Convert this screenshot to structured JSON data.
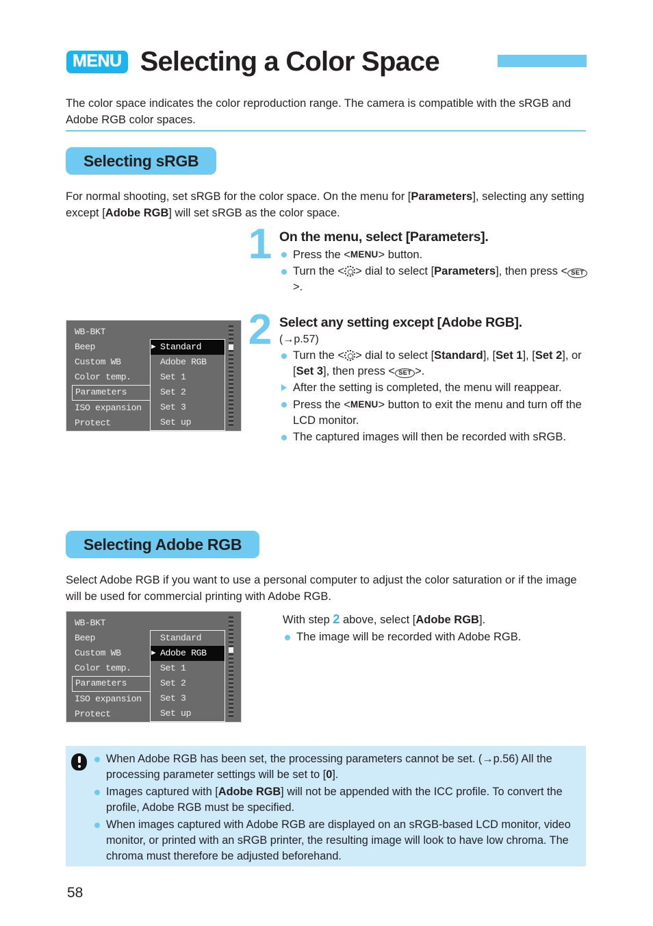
{
  "header": {
    "menu_badge": "MENU",
    "title": "Selecting a Color Space"
  },
  "intro": "The color space indicates the color reproduction range. The camera is compatible with the sRGB and Adobe RGB color spaces.",
  "sections": {
    "srgb": {
      "banner": "Selecting sRGB",
      "description_part1": "For normal shooting, set sRGB for the color space. On the menu for [",
      "description_bold1": "Parameters",
      "description_part2": "], selecting any setting except [",
      "description_bold2": "Adobe RGB",
      "description_part3": "] will set sRGB as the color space."
    },
    "adobergb": {
      "banner": "Selecting Adobe RGB",
      "description": "Select Adobe RGB if you want to use a personal computer to adjust the color saturation or if the image will be used for commercial printing with Adobe RGB."
    }
  },
  "steps": [
    {
      "number": "1",
      "heading": "On the menu, select [Parameters].",
      "bullets": [
        {
          "type": "dot",
          "parts": [
            {
              "t": "Press the <",
              "s": "plain"
            },
            {
              "t": "MENU",
              "s": "menu-icon"
            },
            {
              "t": "> button.",
              "s": "plain"
            }
          ]
        },
        {
          "type": "dot",
          "parts": [
            {
              "t": "Turn the <",
              "s": "plain"
            },
            {
              "t": "",
              "s": "dial-icon"
            },
            {
              "t": "> dial to select [",
              "s": "plain"
            },
            {
              "t": "Parameters",
              "s": "bold"
            },
            {
              "t": "], then press <",
              "s": "plain"
            },
            {
              "t": "SET",
              "s": "set-icon"
            },
            {
              "t": ">.",
              "s": "plain"
            }
          ]
        }
      ]
    },
    {
      "number": "2",
      "heading": "Select any setting except [Adobe RGB].",
      "subtext": "(→p.57)",
      "bullets": [
        {
          "type": "dot",
          "parts": [
            {
              "t": "Turn the <",
              "s": "plain"
            },
            {
              "t": "",
              "s": "dial-icon"
            },
            {
              "t": "> dial to select [",
              "s": "plain"
            },
            {
              "t": "Standard",
              "s": "bold"
            },
            {
              "t": "], [",
              "s": "plain"
            },
            {
              "t": "Set 1",
              "s": "bold"
            },
            {
              "t": "], [",
              "s": "plain"
            },
            {
              "t": "Set 2",
              "s": "bold"
            },
            {
              "t": "], or [",
              "s": "plain"
            },
            {
              "t": "Set 3",
              "s": "bold"
            },
            {
              "t": "], then press <",
              "s": "plain"
            },
            {
              "t": "SET",
              "s": "set-icon"
            },
            {
              "t": ">.",
              "s": "plain"
            }
          ]
        },
        {
          "type": "tri",
          "parts": [
            {
              "t": "After the setting is completed, the menu will reappear.",
              "s": "plain"
            }
          ]
        },
        {
          "type": "dot",
          "parts": [
            {
              "t": "Press the <",
              "s": "plain"
            },
            {
              "t": "MENU",
              "s": "menu-icon"
            },
            {
              "t": "> button to exit the menu and turn off the LCD monitor.",
              "s": "plain"
            }
          ]
        },
        {
          "type": "dot",
          "parts": [
            {
              "t": "The captured images will then be recorded with sRGB.",
              "s": "plain"
            }
          ]
        }
      ]
    }
  ],
  "lcd_screens": [
    {
      "id": "lcd-standard",
      "left_items": [
        {
          "label": "WB-BKT",
          "boxed": false
        },
        {
          "label": "Beep",
          "boxed": false
        },
        {
          "label": "Custom WB",
          "boxed": false
        },
        {
          "label": "Color temp.",
          "boxed": false
        },
        {
          "label": "Parameters",
          "boxed": true
        },
        {
          "label": "ISO expansion",
          "boxed": false
        },
        {
          "label": "Protect",
          "boxed": false
        }
      ],
      "options": [
        {
          "label": "Standard",
          "selected": true
        },
        {
          "label": "Adobe RGB",
          "selected": false
        },
        {
          "label": "Set 1",
          "selected": false
        },
        {
          "label": "Set 2",
          "selected": false
        },
        {
          "label": "Set 3",
          "selected": false
        },
        {
          "label": "Set up",
          "selected": false
        }
      ]
    },
    {
      "id": "lcd-adobergb",
      "left_items": [
        {
          "label": "WB-BKT",
          "boxed": false
        },
        {
          "label": "Beep",
          "boxed": false
        },
        {
          "label": "Custom WB",
          "boxed": false
        },
        {
          "label": "Color temp.",
          "boxed": false
        },
        {
          "label": "Parameters",
          "boxed": true
        },
        {
          "label": "ISO expansion",
          "boxed": false
        },
        {
          "label": "Protect",
          "boxed": false
        }
      ],
      "options": [
        {
          "label": "Standard",
          "selected": false
        },
        {
          "label": "Adobe RGB",
          "selected": true
        },
        {
          "label": "Set 1",
          "selected": false
        },
        {
          "label": "Set 2",
          "selected": false
        },
        {
          "label": "Set 3",
          "selected": false
        },
        {
          "label": "Set up",
          "selected": false
        }
      ]
    }
  ],
  "adobergb_instructions": {
    "lead_part1": "With step ",
    "lead_number": "2",
    "lead_part2": " above, select [",
    "lead_bold": "Adobe RGB",
    "lead_part3": "].",
    "bullet": "The image will be recorded with Adobe RGB."
  },
  "note_box": {
    "icon": "warning-exclamation-icon",
    "items": [
      {
        "parts": [
          {
            "t": "When Adobe RGB has been set, the processing parameters cannot be set. (→p.56) All the processing parameter settings will be set to [",
            "s": "plain"
          },
          {
            "t": "0",
            "s": "bold"
          },
          {
            "t": "].",
            "s": "plain"
          }
        ]
      },
      {
        "parts": [
          {
            "t": "Images captured with [",
            "s": "plain"
          },
          {
            "t": "Adobe RGB",
            "s": "bold"
          },
          {
            "t": "] will not be appended with the ICC profile. To convert the profile, Adobe RGB must be specified.",
            "s": "plain"
          }
        ]
      },
      {
        "parts": [
          {
            "t": "When images captured with Adobe RGB are displayed on an sRGB-based LCD monitor, video monitor, or printed with an sRGB printer, the resulting image will look to have low chroma. The chroma must therefore be adjusted beforehand.",
            "s": "plain"
          }
        ]
      }
    ]
  },
  "footer": {
    "page_number": "58"
  },
  "colors": {
    "accent_blue": "#6ecaf0",
    "menu_badge_blue": "#1ab4ef",
    "note_bg": "#cfeaf8",
    "lcd_bg": "#6b6b6b",
    "text": "#231f20"
  }
}
